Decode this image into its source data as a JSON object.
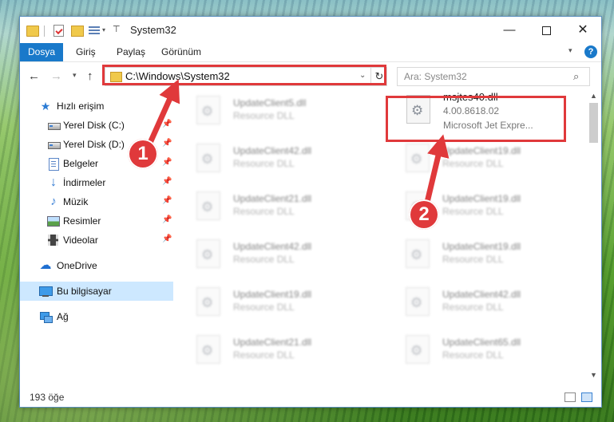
{
  "window": {
    "title": "System32",
    "controls": {
      "minimize": "—",
      "maximize": "",
      "close": "✕"
    }
  },
  "ribbon": {
    "tabs": [
      "Dosya",
      "Giriş",
      "Paylaş",
      "Görünüm"
    ],
    "help": "?"
  },
  "address": {
    "path": "C:\\Windows\\System32",
    "search_placeholder": "Ara: System32"
  },
  "sidebar": {
    "items": [
      {
        "label": "Hızlı erişim",
        "icon": "star-icon"
      },
      {
        "label": "Yerel Disk (C:)",
        "icon": "drive-icon",
        "pinned": true
      },
      {
        "label": "Yerel Disk (D:)",
        "icon": "drive-icon",
        "pinned": true
      },
      {
        "label": "Belgeler",
        "icon": "documents-icon",
        "pinned": true
      },
      {
        "label": "İndirmeler",
        "icon": "download-icon",
        "pinned": true
      },
      {
        "label": "Müzik",
        "icon": "music-icon",
        "pinned": true
      },
      {
        "label": "Resimler",
        "icon": "pictures-icon",
        "pinned": true
      },
      {
        "label": "Videolar",
        "icon": "videos-icon",
        "pinned": true
      },
      {
        "label": "OneDrive",
        "icon": "onedrive-icon"
      },
      {
        "label": "Bu bilgisayar",
        "icon": "computer-icon",
        "selected": true
      },
      {
        "label": "Ağ",
        "icon": "network-icon"
      }
    ]
  },
  "files": {
    "target": {
      "name": "msjtes40.dll",
      "version": "4.00.8618.02",
      "description": "Microsoft Jet Expre..."
    },
    "left_column": [
      {
        "name": "UpdateClient5.dll",
        "type": "Resource DLL"
      },
      {
        "name": "UpdateClient42.dll",
        "type": "Resource DLL"
      },
      {
        "name": "UpdateClient21.dll",
        "type": "Resource DLL"
      },
      {
        "name": "UpdateClient42.dll",
        "type": "Resource DLL"
      },
      {
        "name": "UpdateClient19.dll",
        "type": "Resource DLL"
      },
      {
        "name": "UpdateClient21.dll",
        "type": "Resource DLL"
      }
    ],
    "right_column": [
      {
        "name": "UpdateClient19.dll",
        "type": "Resource DLL"
      },
      {
        "name": "UpdateClient19.dll",
        "type": "Resource DLL"
      },
      {
        "name": "UpdateClient19.dll",
        "type": "Resource DLL"
      },
      {
        "name": "UpdateClient42.dll",
        "type": "Resource DLL"
      },
      {
        "name": "UpdateClient65.dll",
        "type": "Resource DLL"
      }
    ]
  },
  "status": {
    "item_count": "193 öğe"
  },
  "annotations": {
    "step1": "1",
    "step2": "2",
    "color": "#e0393b"
  }
}
